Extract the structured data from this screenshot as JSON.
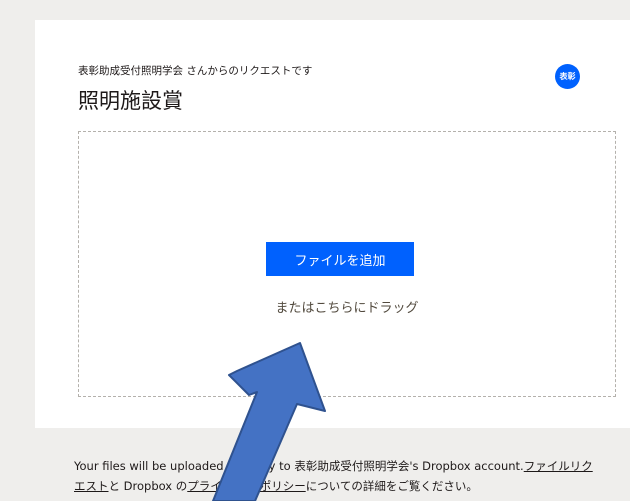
{
  "request": {
    "requester_line": "表彰助成受付照明学会 さんからのリクエストです",
    "title": "照明施設賞",
    "avatar_label": "表彰"
  },
  "dropzone": {
    "add_button_label": "ファイルを追加",
    "drag_text": "またはこちらにドラッグ"
  },
  "footer": {
    "text_before": "Your files will be uploaded securely to 表彰助成受付照明学会's Dropbox account.",
    "link_file_request": "ファイルリクエスト",
    "text_middle": "と Dropbox の",
    "link_privacy_policy": "プライバシー ポリシー",
    "text_after": "についての詳細をご覧ください。"
  },
  "colors": {
    "accent": "#0061fe",
    "background": "#efeeec",
    "card": "#ffffff",
    "annotation_arrow": "#4472c4"
  },
  "annotation": {
    "type": "arrow",
    "points_to": "add-file-button"
  }
}
